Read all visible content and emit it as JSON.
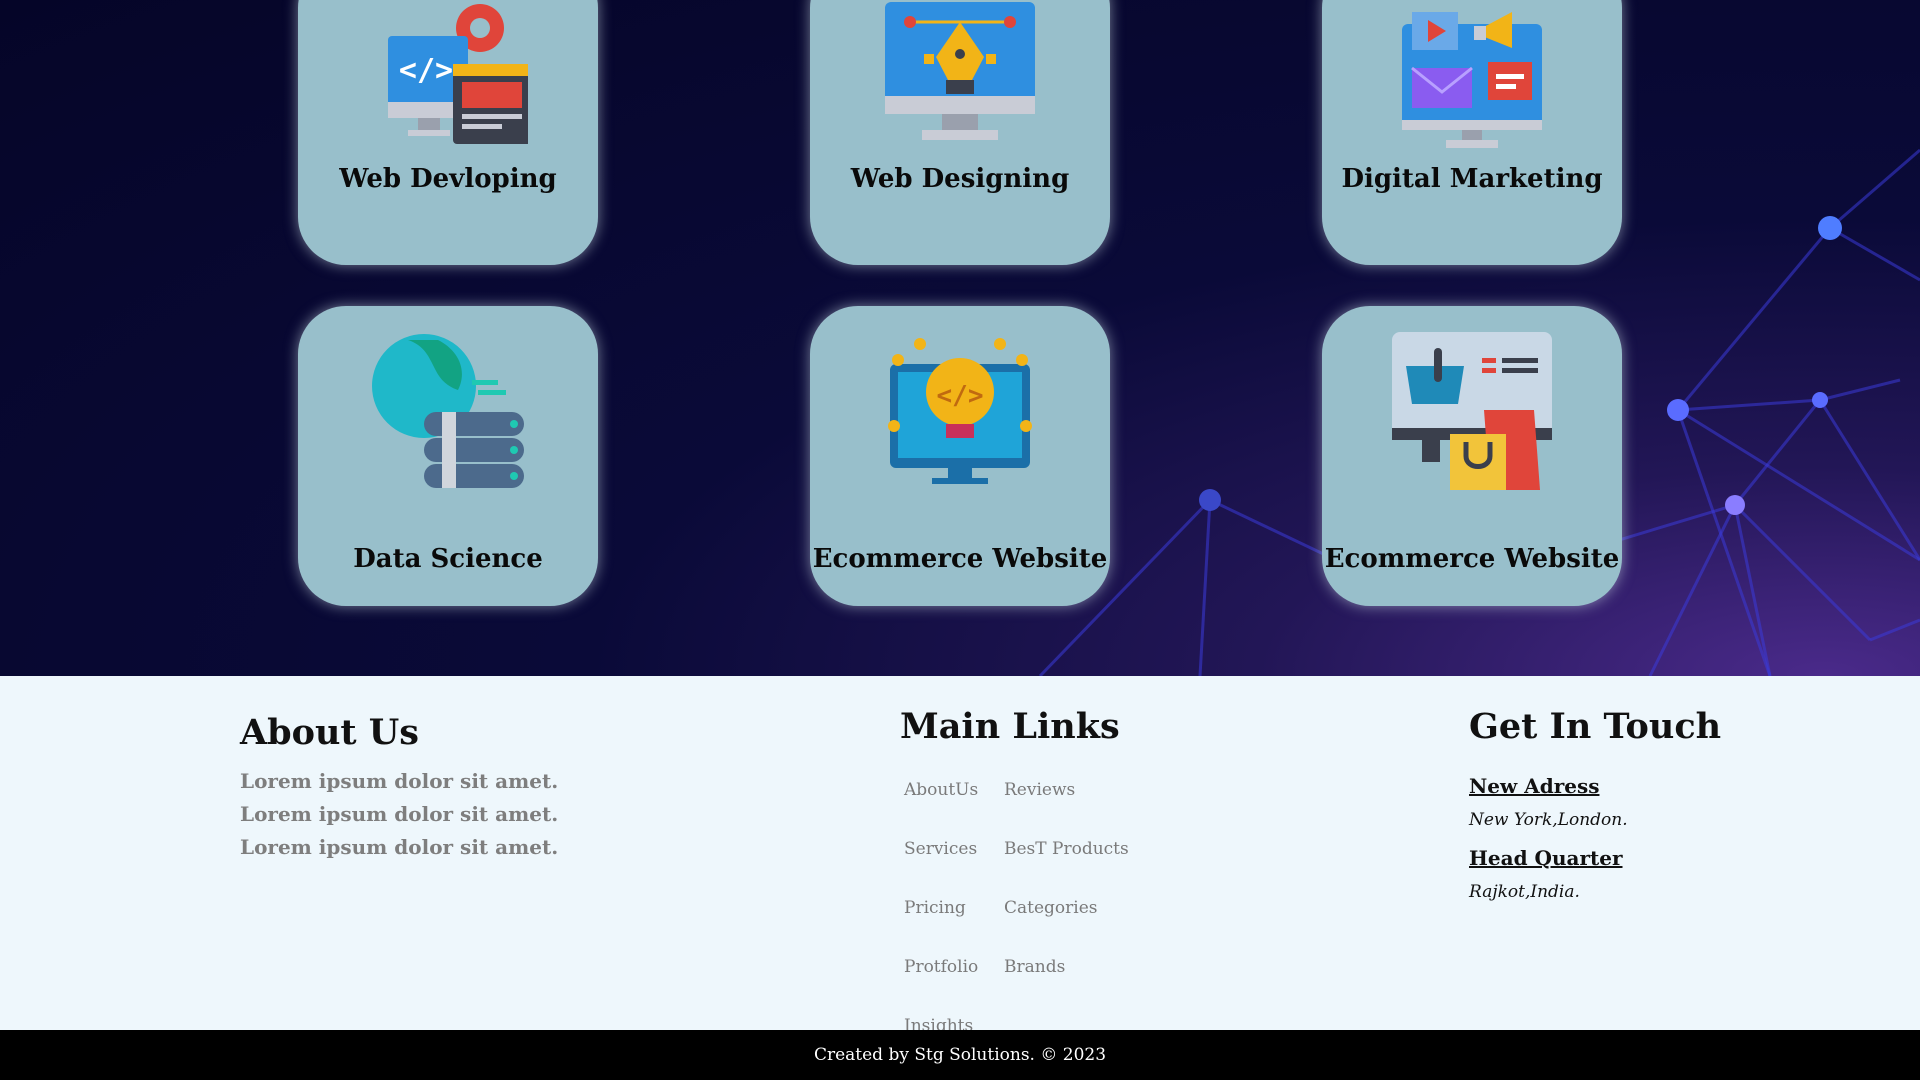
{
  "services": [
    {
      "title": "Web Devloping",
      "icon": "web-developing-icon"
    },
    {
      "title": "Web Designing",
      "icon": "web-designing-icon"
    },
    {
      "title": "Digital Marketing",
      "icon": "digital-marketing-icon"
    },
    {
      "title": "Data Science",
      "icon": "data-science-icon"
    },
    {
      "title": "Ecommerce Website",
      "icon": "idea-monitor-icon"
    },
    {
      "title": "Ecommerce Website",
      "icon": "shopping-bag-icon"
    }
  ],
  "footer": {
    "about": {
      "heading": "About Us",
      "lines": [
        "Lorem ipsum dolor sit amet.",
        "Lorem ipsum dolor sit amet.",
        "Lorem ipsum dolor sit amet."
      ]
    },
    "links": {
      "heading": "Main Links",
      "col1": [
        "AboutUs",
        "Services",
        "Pricing",
        "Protfolio",
        "Insights"
      ],
      "col2": [
        "Reviews",
        "BesT Products",
        "Categories",
        "Brands"
      ]
    },
    "touch": {
      "heading": "Get In Touch",
      "address_label": "New Adress",
      "address_value": "New York,London.",
      "hq_label": "Head Quarter",
      "hq_value": "Rajkot,India."
    },
    "copyright": "Created by Stg Solutions. © 2023"
  },
  "colors": {
    "card_bg": "#98bfcb",
    "section_bg": "#050528",
    "footer_bg": "#eef7fc",
    "copyright_bg": "#000000"
  }
}
